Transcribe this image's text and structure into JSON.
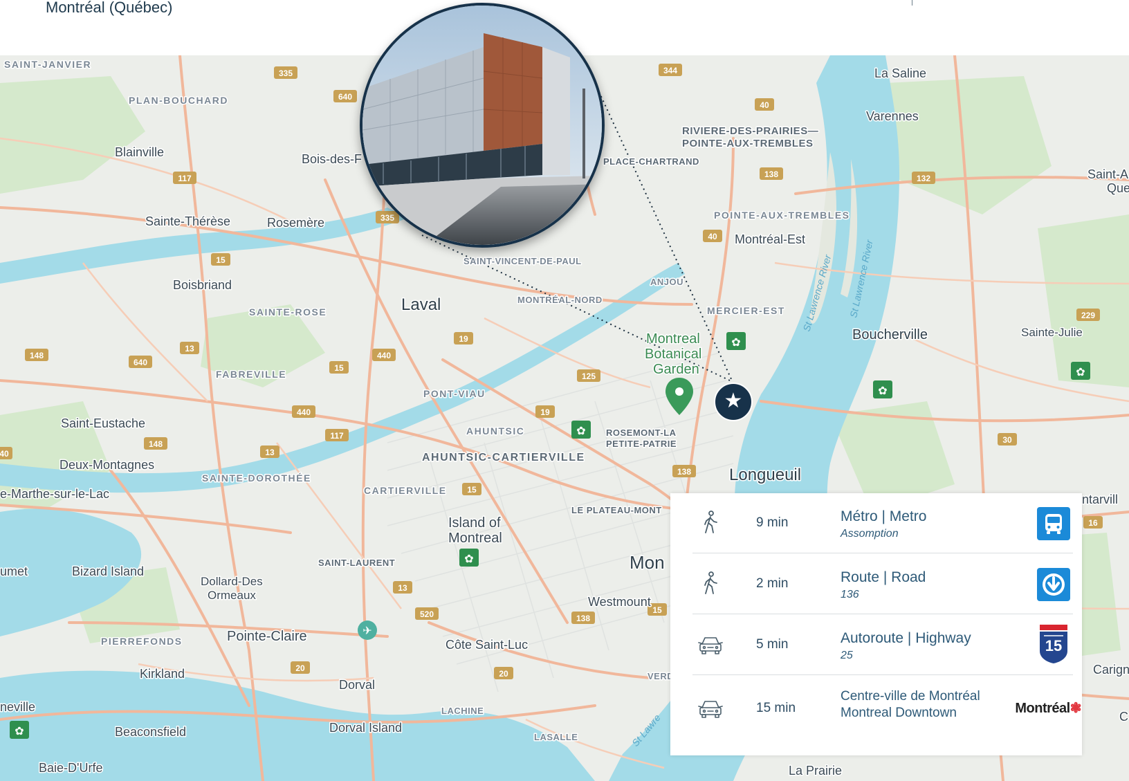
{
  "header": {
    "address": "Montréal (Québec)"
  },
  "map": {
    "labels": {
      "saint_janvier": "SAINT-JANVIER",
      "plan_bouchard": "PLAN-BOUCHARD",
      "blainville": "Blainville",
      "bois_des": "Bois-des-F",
      "sainte_therese": "Sainte-Thérèse",
      "rosemere": "Rosemère",
      "boisbriand": "Boisbriand",
      "sainte_rose": "SAINTE-ROSE",
      "laval": "Laval",
      "fabreville": "FABREVILLE",
      "saint_eustache": "Saint-Eustache",
      "deux_montagnes": "Deux-Montagnes",
      "sainte_dorothee": "SAINTE-DOROTHÉE",
      "sainte_marthe": "e-Marthe-sur-le-Lac",
      "cartierville": "CARTIERVILLE",
      "ahuntsic": "AHUNTSIC",
      "ahuntsic_cartierville": "AHUNTSIC-CARTIERVILLE",
      "pont_viau": "PONT-VIAU",
      "saint_vincent": "SAINT-VINCENT-DE-PAUL",
      "montreal_nord": "MONTRÉAL-NORD",
      "anjou": "ANJOU",
      "mercier_est": "MERCIER-EST",
      "rosemont_1": "ROSEMONT-LA",
      "rosemont_2": "PETITE-PATRIE",
      "plateau": "LE PLATEAU-MONT",
      "island_1": "Island of",
      "island_2": "Montreal",
      "saint_laurent": "SAINT-LAURENT",
      "bizard": "Bizard Island",
      "dollard_1": "Dollard-Des",
      "dollard_2": "Ormeaux",
      "pierrefonds": "PIERREFONDS",
      "pointe_claire": "Pointe-Claire",
      "kirkland": "Kirkland",
      "dorval": "Dorval",
      "dorval_island": "Dorval Island",
      "lachine": "LACHINE",
      "lasalle": "LASALLE",
      "beaconsfield": "Beaconsfield",
      "baie_durfe": "Baie-D'Urfe",
      "neville": "neville",
      "umet": "umet",
      "cote_saint_luc": "Côte Saint-Luc",
      "westmount": "Westmount",
      "mon": "Mon",
      "verd": "VERD",
      "longueuil": "Longueuil",
      "la_saline": "La Saline",
      "varennes": "Varennes",
      "rdp_1": "RIVIERE-DES-PRAIRIES—",
      "rdp_2": "POINTE-AUX-TREMBLES",
      "place_chartrand": "PLACE-CHARTRAND",
      "pat": "POINTE-AUX-TREMBLES",
      "montreal_est": "Montréal-Est",
      "boucherville": "Boucherville",
      "sainte_julie": "Sainte-Julie",
      "saint_a_1": "Saint-A",
      "saint_a_2": "Que",
      "ntarvill": "ntarvill",
      "carign": "Carign",
      "c_edge": "C",
      "la_prairie": "La Prairie",
      "garden_1": "Montreal",
      "garden_2": "Botanical",
      "garden_3": "Garden",
      "river_1": "St Lawrence River",
      "river_2": "St Lawrence River",
      "river_3": "St Lawre"
    },
    "shields": {
      "s335a": "335",
      "s640a": "640",
      "s344": "344",
      "s40a": "40",
      "s138a": "138",
      "s132": "132",
      "s117a": "117",
      "s335b": "335",
      "s40b": "40",
      "s15a": "15",
      "s19a": "19",
      "s440a": "440",
      "s15b": "15",
      "s13a": "13",
      "s640b": "640",
      "s148a": "148",
      "s125": "125",
      "s19b": "19",
      "s440b": "440",
      "s117b": "117",
      "s148b": "148",
      "s13b": "13",
      "s138b": "138",
      "s15c": "15",
      "s229": "229",
      "s30": "30",
      "s16": "16",
      "s13c": "13",
      "s520": "520",
      "s138c": "138",
      "s15d": "15",
      "s20a": "20",
      "s20b": "20",
      "s40c": "40"
    }
  },
  "panel": {
    "rows": [
      {
        "time": "9 min",
        "title": "Métro | Metro",
        "subtitle": "Assomption",
        "mode": "walk-icon",
        "badge": "bus-icon"
      },
      {
        "time": "2 min",
        "title": "Route | Road",
        "subtitle": "136",
        "mode": "walk-icon",
        "badge": "metro-icon"
      },
      {
        "time": "5 min",
        "title": "Autoroute | Highway",
        "subtitle": "25",
        "mode": "car-icon",
        "badge": "highway-15-shield-icon",
        "badge_number": "15"
      },
      {
        "time": "15 min",
        "title_line1": "Centre-ville de Montréal",
        "title_line2": "Montreal Downtown",
        "mode": "car-icon",
        "badge": "montreal-logo",
        "logo_text": "Montréal"
      }
    ]
  },
  "colors": {
    "land": "#eceeea",
    "water": "#a3dbe8",
    "park": "#cfe8c4",
    "road": "#f3b99c",
    "marker": "#17324a",
    "accent": "#2e5a78"
  }
}
